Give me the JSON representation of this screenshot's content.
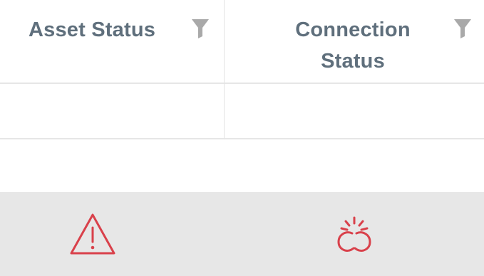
{
  "table": {
    "columns": [
      {
        "label": "Asset Status",
        "filter_icon": "filter-icon"
      },
      {
        "label": "Connection\nStatus",
        "filter_icon": "filter-icon"
      }
    ],
    "rows": [
      {
        "asset_status": "",
        "connection_status": ""
      },
      {
        "asset_status": "",
        "connection_status": ""
      },
      {
        "asset_status_icon": "warning-icon",
        "connection_status_icon": "broken-link-icon"
      }
    ]
  },
  "colors": {
    "header_text": "#5f6f7c",
    "filter_icon": "#a9a9a9",
    "status_red": "#d9414b",
    "highlight_row": "#e7e7e7",
    "divider": "#e6e6e6"
  }
}
